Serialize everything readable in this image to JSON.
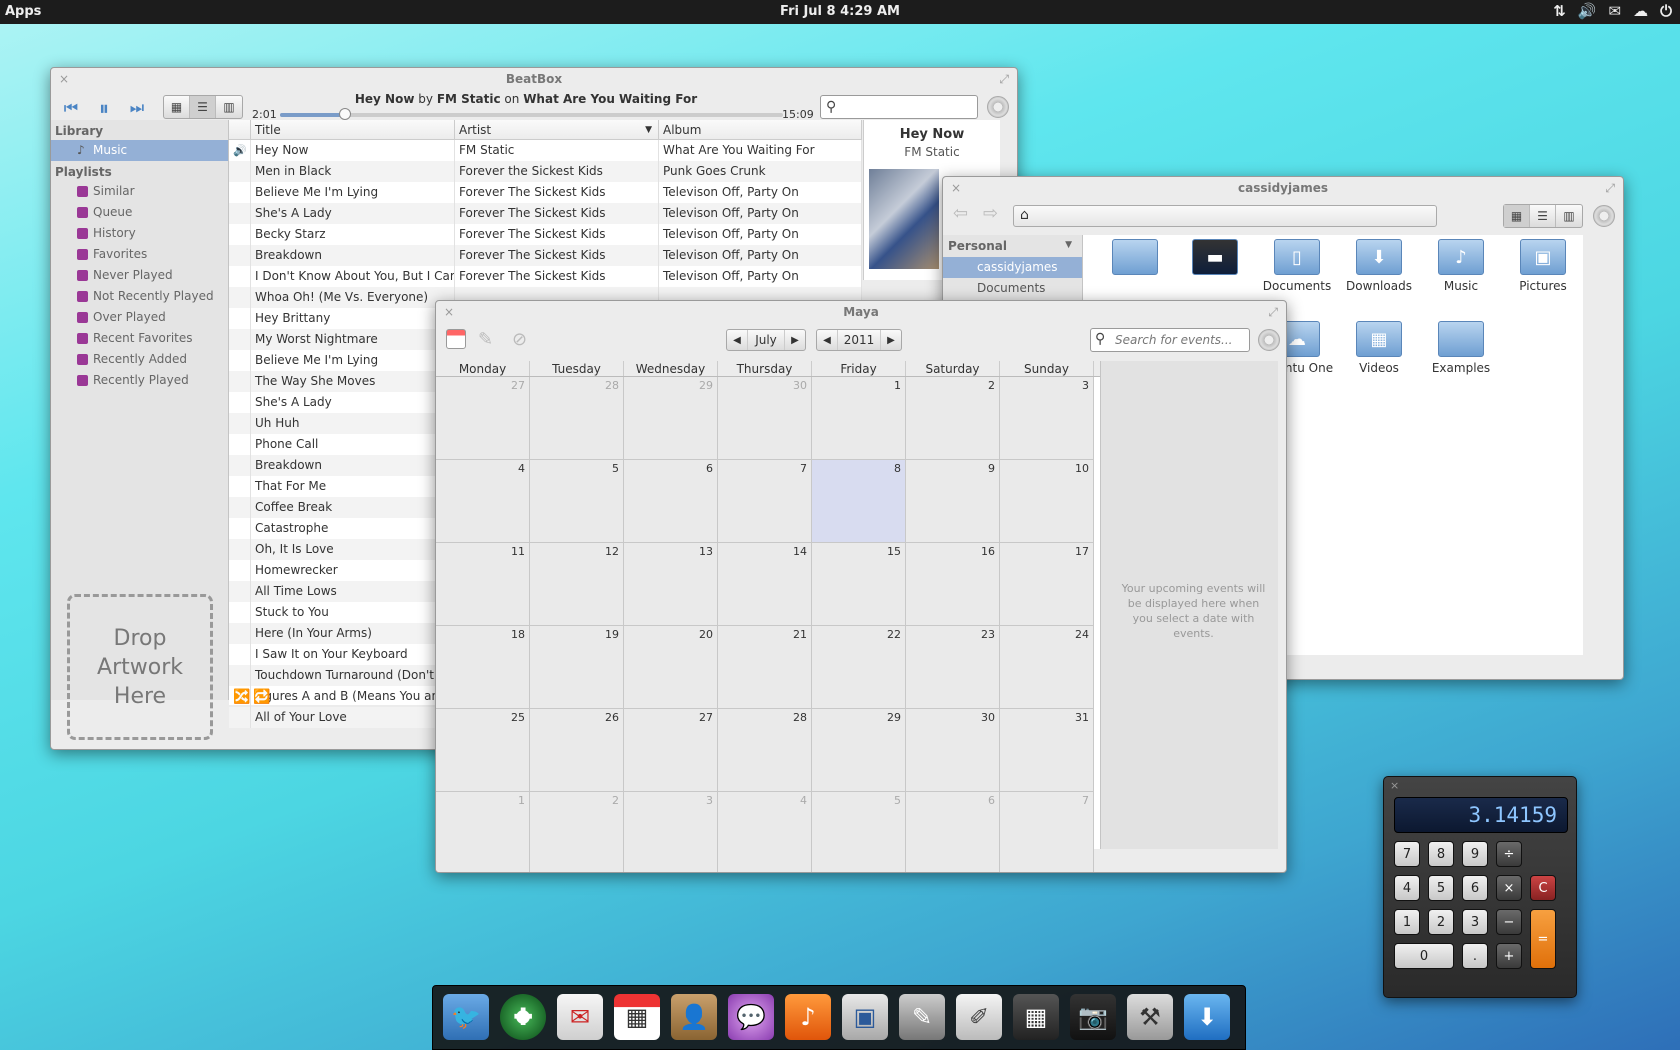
{
  "topbar": {
    "apps": "Apps",
    "clock": "Fri Jul  8  4:29 AM"
  },
  "beatbox": {
    "title": "BeatBox",
    "now_track": "Hey Now",
    "now_by": "by",
    "now_artist": "FM Static",
    "now_on": "on",
    "now_album": "What Are You Waiting For",
    "elapsed": "2:01",
    "total": "15:09",
    "progress": 0.13,
    "library_header": "Library",
    "music": "Music",
    "playlists_header": "Playlists",
    "playlists": [
      "Similar",
      "Queue",
      "History",
      "Favorites",
      "Never Played",
      "Not Recently Played",
      "Over Played",
      "Recent Favorites",
      "Recently Added",
      "Recently Played"
    ],
    "drop": "Drop\nArtwork\nHere",
    "columns": [
      "Title",
      "Artist",
      "Album"
    ],
    "rows": [
      [
        "Hey Now",
        "FM Static",
        "What Are You Waiting For"
      ],
      [
        "Men in Black",
        "Forever the Sickest Kids",
        "Punk Goes Crunk"
      ],
      [
        "Believe Me I'm Lying",
        "Forever The Sickest Kids",
        "Televison Off, Party On"
      ],
      [
        "She's A Lady",
        "Forever The Sickest Kids",
        "Televison Off, Party On"
      ],
      [
        "Becky Starz",
        "Forever The Sickest Kids",
        "Televison Off, Party On"
      ],
      [
        "Breakdown",
        "Forever The Sickest Kids",
        "Televison Off, Party On"
      ],
      [
        "I Don't Know About You, But I Came T",
        "Forever The Sickest Kids",
        "Televison Off, Party On"
      ],
      [
        "Whoa Oh! (Me Vs. Everyone)",
        "",
        ""
      ],
      [
        "Hey Brittany",
        "",
        ""
      ],
      [
        "My Worst Nightmare",
        "",
        ""
      ],
      [
        "Believe Me I'm Lying",
        "",
        ""
      ],
      [
        "The Way She Moves",
        "",
        ""
      ],
      [
        "She's A Lady",
        "",
        ""
      ],
      [
        "Uh Huh",
        "",
        ""
      ],
      [
        "Phone Call",
        "",
        ""
      ],
      [
        "Breakdown",
        "",
        ""
      ],
      [
        "That For Me",
        "",
        ""
      ],
      [
        "Coffee Break",
        "",
        ""
      ],
      [
        "Catastrophe",
        "",
        ""
      ],
      [
        "Oh, It Is Love",
        "",
        ""
      ],
      [
        "Homewrecker",
        "",
        ""
      ],
      [
        "All Time Lows",
        "",
        ""
      ],
      [
        "Stuck to You",
        "",
        ""
      ],
      [
        "Here (In Your Arms)",
        "",
        ""
      ],
      [
        "I Saw It on Your Keyboard",
        "",
        ""
      ],
      [
        "Touchdown Turnaround (Don't G",
        "",
        ""
      ],
      [
        "Figures A and B (Means You and M",
        "",
        ""
      ],
      [
        "All of Your Love",
        "",
        ""
      ]
    ],
    "info_title": "Hey Now",
    "info_artist": "FM Static"
  },
  "files": {
    "title": "cassidyjames",
    "personal": "Personal",
    "side": [
      "cassidyjames",
      "Documents"
    ],
    "icons": [
      "",
      "",
      "Documents",
      "Downloads",
      "Music",
      "Pictures",
      "Ubuntu One",
      "Videos",
      "Examples"
    ]
  },
  "maya": {
    "title": "Maya",
    "month": "July",
    "year": "2011",
    "search_placeholder": "Search for events...",
    "days": [
      "Monday",
      "Tuesday",
      "Wednesday",
      "Thursday",
      "Friday",
      "Saturday",
      "Sunday"
    ],
    "weeks": [
      [
        "27",
        "28",
        "29",
        "30",
        "1",
        "2",
        "3"
      ],
      [
        "4",
        "5",
        "6",
        "7",
        "8",
        "9",
        "10"
      ],
      [
        "11",
        "12",
        "13",
        "14",
        "15",
        "16",
        "17"
      ],
      [
        "18",
        "19",
        "20",
        "21",
        "22",
        "23",
        "24"
      ],
      [
        "25",
        "26",
        "27",
        "28",
        "29",
        "30",
        "31"
      ],
      [
        "1",
        "2",
        "3",
        "4",
        "5",
        "6",
        "7"
      ]
    ],
    "upcoming": "Your upcoming events will be displayed here when you select a date with events."
  },
  "calculator": {
    "display": "3.14159",
    "keys": [
      "7",
      "8",
      "9",
      "÷",
      "4",
      "5",
      "6",
      "×",
      "C",
      "1",
      "2",
      "3",
      "−",
      "=",
      "0",
      ".",
      "+"
    ]
  },
  "colors": {
    "accent": "#94b0d6",
    "playlist_icon": "#9a3896"
  }
}
